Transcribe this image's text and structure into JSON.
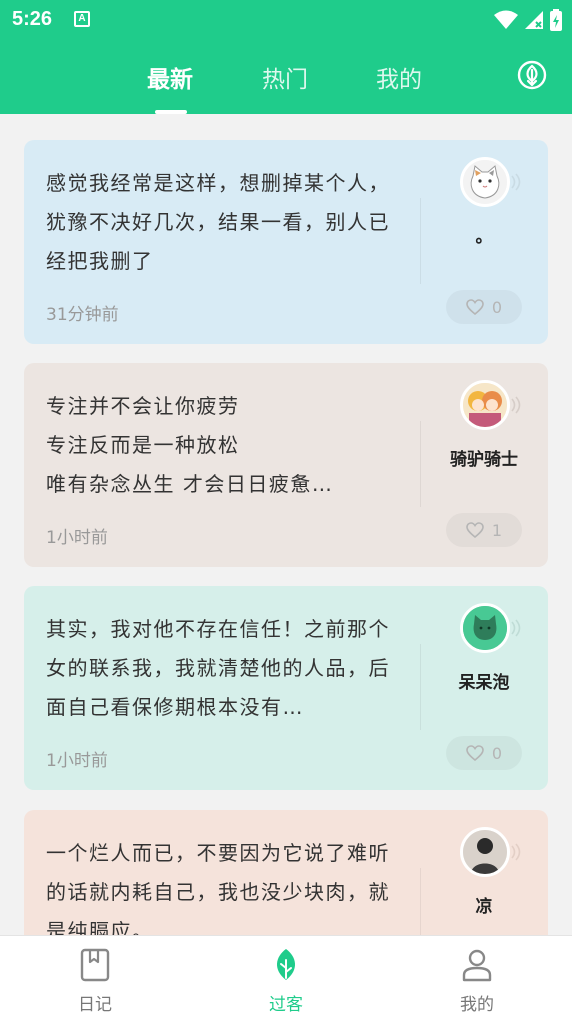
{
  "status_bar": {
    "time": "5:26",
    "notification_letter": "A"
  },
  "header": {
    "tabs": [
      {
        "label": "最新",
        "active": true
      },
      {
        "label": "热门",
        "active": false
      },
      {
        "label": "我的",
        "active": false
      }
    ],
    "action_icon": "leaf-down-circle-icon"
  },
  "colors": {
    "brand": "#1fcc8b"
  },
  "cards": [
    {
      "text": "感觉我经常是这样，想删掉某个人，犹豫不决好几次，结果一看，别人已经把我删了",
      "time": "31分钟前",
      "nickname": "。",
      "likes": "0",
      "bg": "#d8ebf5",
      "avatar": "cat-avatar"
    },
    {
      "text": "专注并不会让你疲劳\n专注反而是一种放松\n唯有杂念丛生 才会日日疲惫…",
      "time": "1小时前",
      "nickname": "骑驴骑士",
      "likes": "1",
      "bg": "#ece5e1",
      "avatar": "anime-girls-avatar"
    },
    {
      "text": "其实，我对他不存在信任！之前那个女的联系我，我就清楚他的人品，后面自己看保修期根本没有…",
      "time": "1小时前",
      "nickname": "呆呆泡",
      "likes": "0",
      "bg": "#d6efea",
      "avatar": "green-cat-avatar"
    },
    {
      "text": "一个烂人而已，不要因为它说了难听的话就内耗自己，我也没少块肉，就是纯膈应。",
      "time": "",
      "nickname": "凉",
      "likes": "",
      "bg": "#f5e3db",
      "avatar": "person-avatar"
    }
  ],
  "bottom_nav": [
    {
      "label": "日记",
      "icon": "diary-icon",
      "active": false
    },
    {
      "label": "过客",
      "icon": "leaf-icon",
      "active": true
    },
    {
      "label": "我的",
      "icon": "user-icon",
      "active": false
    }
  ]
}
